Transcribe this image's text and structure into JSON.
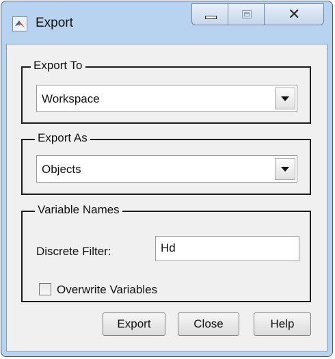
{
  "window": {
    "title": "Export",
    "icon": "matlab-membrane-icon",
    "caption_buttons": [
      "minimize-icon",
      "maximize-icon",
      "close-icon"
    ]
  },
  "export_to": {
    "label": "Export To",
    "value": "Workspace"
  },
  "export_as": {
    "label": "Export As",
    "value": "Objects"
  },
  "variable_names": {
    "label": "Variable Names",
    "discrete_filter_label": "Discrete Filter:",
    "discrete_filter_value": "Hd",
    "overwrite_label": "Overwrite Variables",
    "overwrite_checked": false
  },
  "buttons": {
    "export": "Export",
    "close": "Close",
    "help": "Help"
  }
}
